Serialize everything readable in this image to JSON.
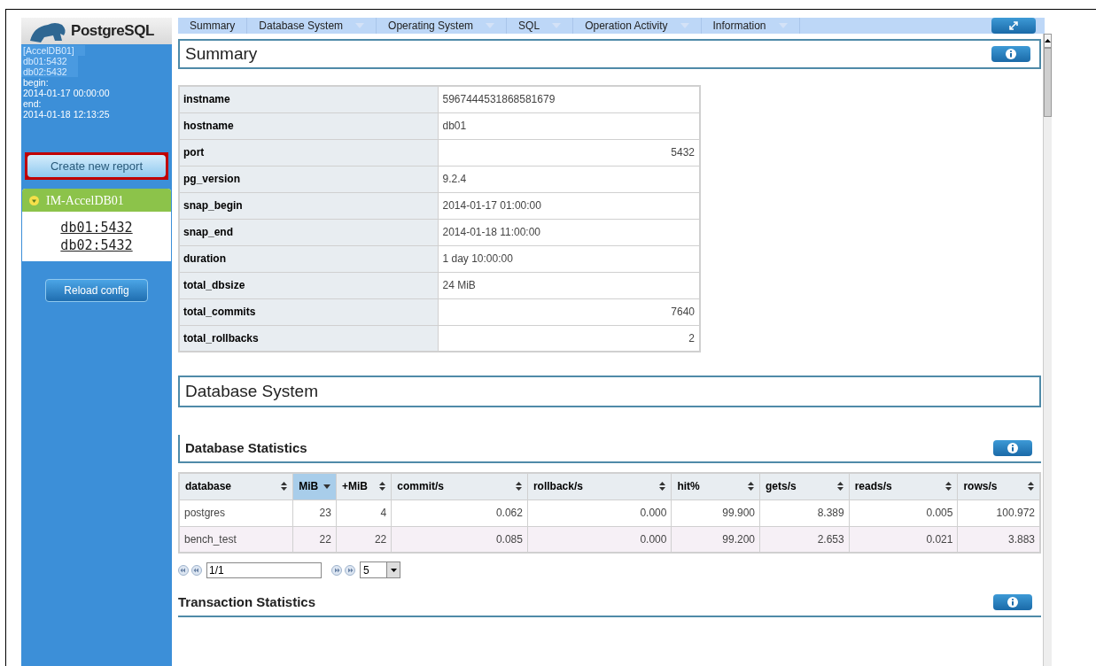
{
  "sidebar": {
    "logo_text": "PostgreSQL",
    "info_lines": [
      {
        "text": "[AccelDB01]",
        "kind": "host"
      },
      {
        "text": "db01:5432",
        "kind": "host"
      },
      {
        "text": "db02:5432",
        "kind": "host"
      },
      {
        "text": "begin:",
        "kind": "plain"
      },
      {
        "text": "2014-01-17 00:00:00",
        "kind": "plain"
      },
      {
        "text": "end:",
        "kind": "plain"
      },
      {
        "text": "2014-01-18 12:13:25",
        "kind": "plain"
      }
    ],
    "create_button": {
      "label": "Create new report",
      "highlighted": true
    },
    "group": {
      "title": "IM-AccelDB01",
      "expanded": true,
      "items": [
        "db01:5432",
        "db02:5432"
      ]
    },
    "reload_button": "Reload config"
  },
  "menu": [
    {
      "label": "Summary",
      "has_menu": false
    },
    {
      "label": "Database System",
      "has_menu": true
    },
    {
      "label": "Operating System",
      "has_menu": true
    },
    {
      "label": "SQL",
      "has_menu": true
    },
    {
      "label": "Operation Activity",
      "has_menu": true
    },
    {
      "label": "Information",
      "has_menu": true
    }
  ],
  "summary": {
    "title": "Summary",
    "rows": [
      {
        "key": "instname",
        "value": "5967444531868581679",
        "kind": "text"
      },
      {
        "key": "hostname",
        "value": "db01",
        "kind": "text"
      },
      {
        "key": "port",
        "value": "5432",
        "kind": "number"
      },
      {
        "key": "pg_version",
        "value": "9.2.4",
        "kind": "text"
      },
      {
        "key": "snap_begin",
        "value": "2014-01-17 01:00:00",
        "kind": "text"
      },
      {
        "key": "snap_end",
        "value": "2014-01-18 11:00:00",
        "kind": "text"
      },
      {
        "key": "duration",
        "value": "1 day 10:00:00",
        "kind": "text"
      },
      {
        "key": "total_dbsize",
        "value": "24 MiB",
        "kind": "text"
      },
      {
        "key": "total_commits",
        "value": "7640",
        "kind": "number"
      },
      {
        "key": "total_rollbacks",
        "value": "2",
        "kind": "number"
      }
    ]
  },
  "database_system": {
    "title": "Database System",
    "statistics": {
      "title": "Database Statistics",
      "columns": [
        {
          "label": "database",
          "sorted": false
        },
        {
          "label": "MiB",
          "sorted": true
        },
        {
          "label": "+MiB",
          "sorted": false
        },
        {
          "label": "commit/s",
          "sorted": false
        },
        {
          "label": "rollback/s",
          "sorted": false
        },
        {
          "label": "hit%",
          "sorted": false
        },
        {
          "label": "gets/s",
          "sorted": false
        },
        {
          "label": "reads/s",
          "sorted": false
        },
        {
          "label": "rows/s",
          "sorted": false
        }
      ],
      "rows": [
        [
          "postgres",
          "23",
          "4",
          "0.062",
          "0.000",
          "99.900",
          "8.389",
          "0.005",
          "100.972"
        ],
        [
          "bench_test",
          "22",
          "22",
          "0.085",
          "0.000",
          "99.200",
          "2.653",
          "0.021",
          "3.883"
        ]
      ],
      "pager": {
        "page": "1/1",
        "page_size": "5"
      }
    },
    "transaction_title": "Transaction Statistics"
  }
}
